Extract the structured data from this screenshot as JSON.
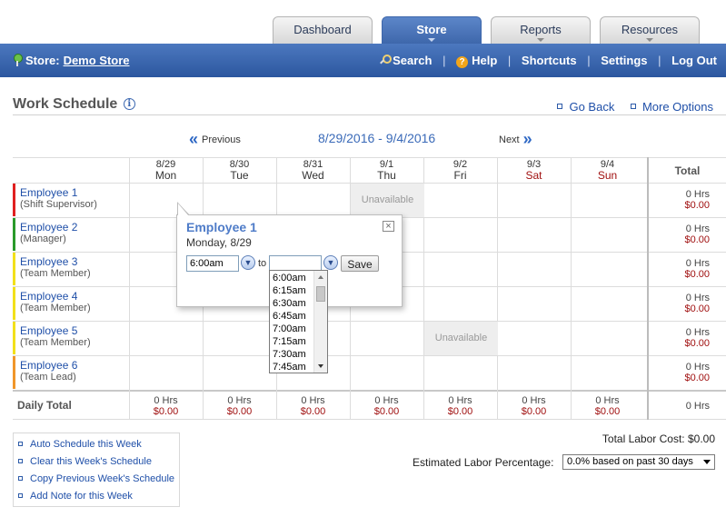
{
  "tabs": [
    {
      "label": "Dashboard",
      "active": false
    },
    {
      "label": "Store",
      "active": true
    },
    {
      "label": "Reports",
      "active": false
    },
    {
      "label": "Resources",
      "active": false
    }
  ],
  "store": {
    "prefix": "Store:",
    "name": "Demo Store"
  },
  "topnav": {
    "search": "Search",
    "help": "Help",
    "shortcuts": "Shortcuts",
    "settings": "Settings",
    "logout": "Log Out",
    "separator": "|"
  },
  "page": {
    "title": "Work Schedule",
    "info_icon": "i",
    "go_back": "Go Back",
    "more_options": "More Options"
  },
  "week": {
    "previous": "Previous",
    "range": "8/29/2016 - 9/4/2016",
    "next": "Next"
  },
  "columns": [
    {
      "date": "8/29",
      "day": "Mon"
    },
    {
      "date": "8/30",
      "day": "Tue"
    },
    {
      "date": "8/31",
      "day": "Wed"
    },
    {
      "date": "9/1",
      "day": "Thu"
    },
    {
      "date": "9/2",
      "day": "Fri"
    },
    {
      "date": "9/3",
      "day": "Sat"
    },
    {
      "date": "9/4",
      "day": "Sun"
    }
  ],
  "total_header": "Total",
  "unavailable_label": "Unavailable",
  "employees": [
    {
      "name": "Employee 1",
      "role": "(Shift Supervisor)",
      "color": "#e02020",
      "hrs": "0 Hrs",
      "cost": "$0.00"
    },
    {
      "name": "Employee 2",
      "role": "(Manager)",
      "color": "#2a9a2a",
      "hrs": "0 Hrs",
      "cost": "$0.00"
    },
    {
      "name": "Employee 3",
      "role": "(Team Member)",
      "color": "#f2e01a",
      "hrs": "0 Hrs",
      "cost": "$0.00"
    },
    {
      "name": "Employee 4",
      "role": "(Team Member)",
      "color": "#f2e01a",
      "hrs": "0 Hrs",
      "cost": "$0.00"
    },
    {
      "name": "Employee 5",
      "role": "(Team Member)",
      "color": "#f2e01a",
      "hrs": "0 Hrs",
      "cost": "$0.00"
    },
    {
      "name": "Employee 6",
      "role": "(Team Lead)",
      "color": "#f0962a",
      "hrs": "0 Hrs",
      "cost": "$0.00"
    }
  ],
  "daily": {
    "label": "Daily Total",
    "values": [
      {
        "hrs": "0 Hrs",
        "cost": "$0.00"
      },
      {
        "hrs": "0 Hrs",
        "cost": "$0.00"
      },
      {
        "hrs": "0 Hrs",
        "cost": "$0.00"
      },
      {
        "hrs": "0 Hrs",
        "cost": "$0.00"
      },
      {
        "hrs": "0 Hrs",
        "cost": "$0.00"
      },
      {
        "hrs": "0 Hrs",
        "cost": "$0.00"
      },
      {
        "hrs": "0 Hrs",
        "cost": "$0.00"
      }
    ],
    "total_hrs": "0 Hrs"
  },
  "popup": {
    "name": "Employee 1",
    "date": "Monday, 8/29",
    "start": "6:00am",
    "end": "",
    "to": "to",
    "save": "Save",
    "close": "×",
    "options": [
      "6:00am",
      "6:15am",
      "6:30am",
      "6:45am",
      "7:00am",
      "7:15am",
      "7:30am",
      "7:45am"
    ]
  },
  "actions": [
    "Auto Schedule this Week",
    "Clear this Week's Schedule",
    "Copy Previous Week's Schedule",
    "Add Note for this Week"
  ],
  "labor": {
    "cost_label": "Total Labor Cost:",
    "cost_value": "$0.00",
    "pct_label": "Estimated Labor Percentage:",
    "pct_value": "0.0% based on past 30 days"
  }
}
